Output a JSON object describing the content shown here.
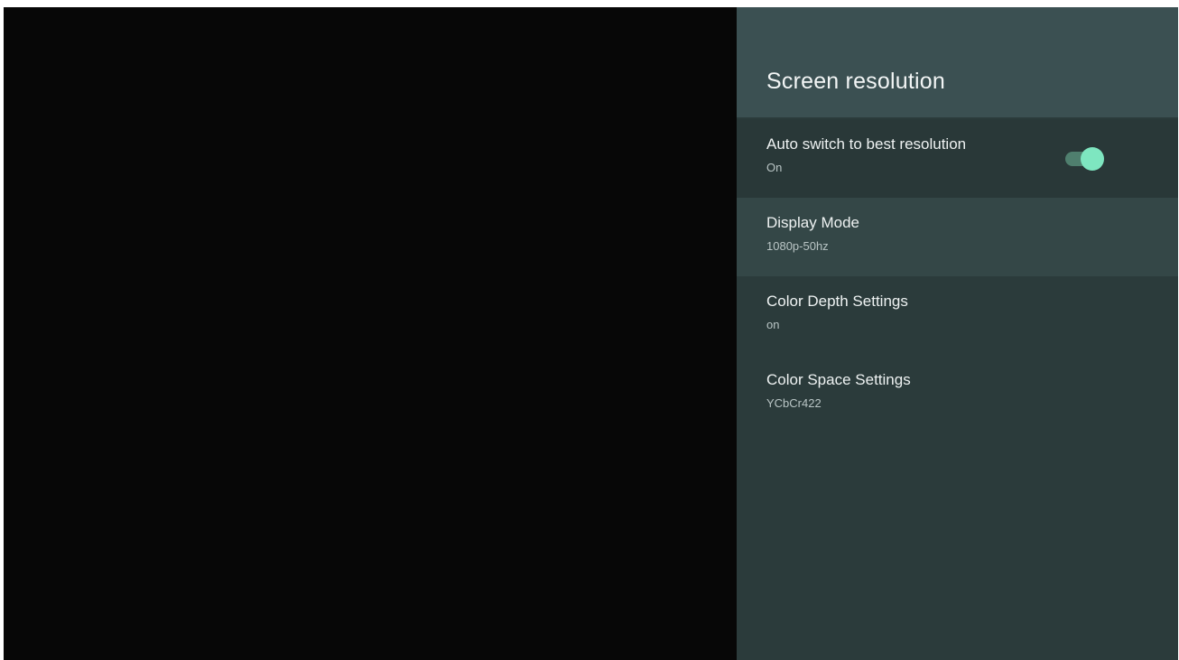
{
  "panel": {
    "title": "Screen resolution",
    "items": [
      {
        "title": "Auto switch to best resolution",
        "summary": "On",
        "toggle": "on"
      },
      {
        "title": "Display Mode",
        "summary": "1080p-50hz"
      },
      {
        "title": "Color Depth Settings",
        "summary": "on"
      },
      {
        "title": "Color Space Settings",
        "summary": "YCbCr422"
      }
    ]
  },
  "colors": {
    "background": "#070707",
    "panel": "#2b3b3b",
    "header": "#3b5052",
    "focused_row": "#344747",
    "toggle_accent": "#7ee6c0"
  }
}
